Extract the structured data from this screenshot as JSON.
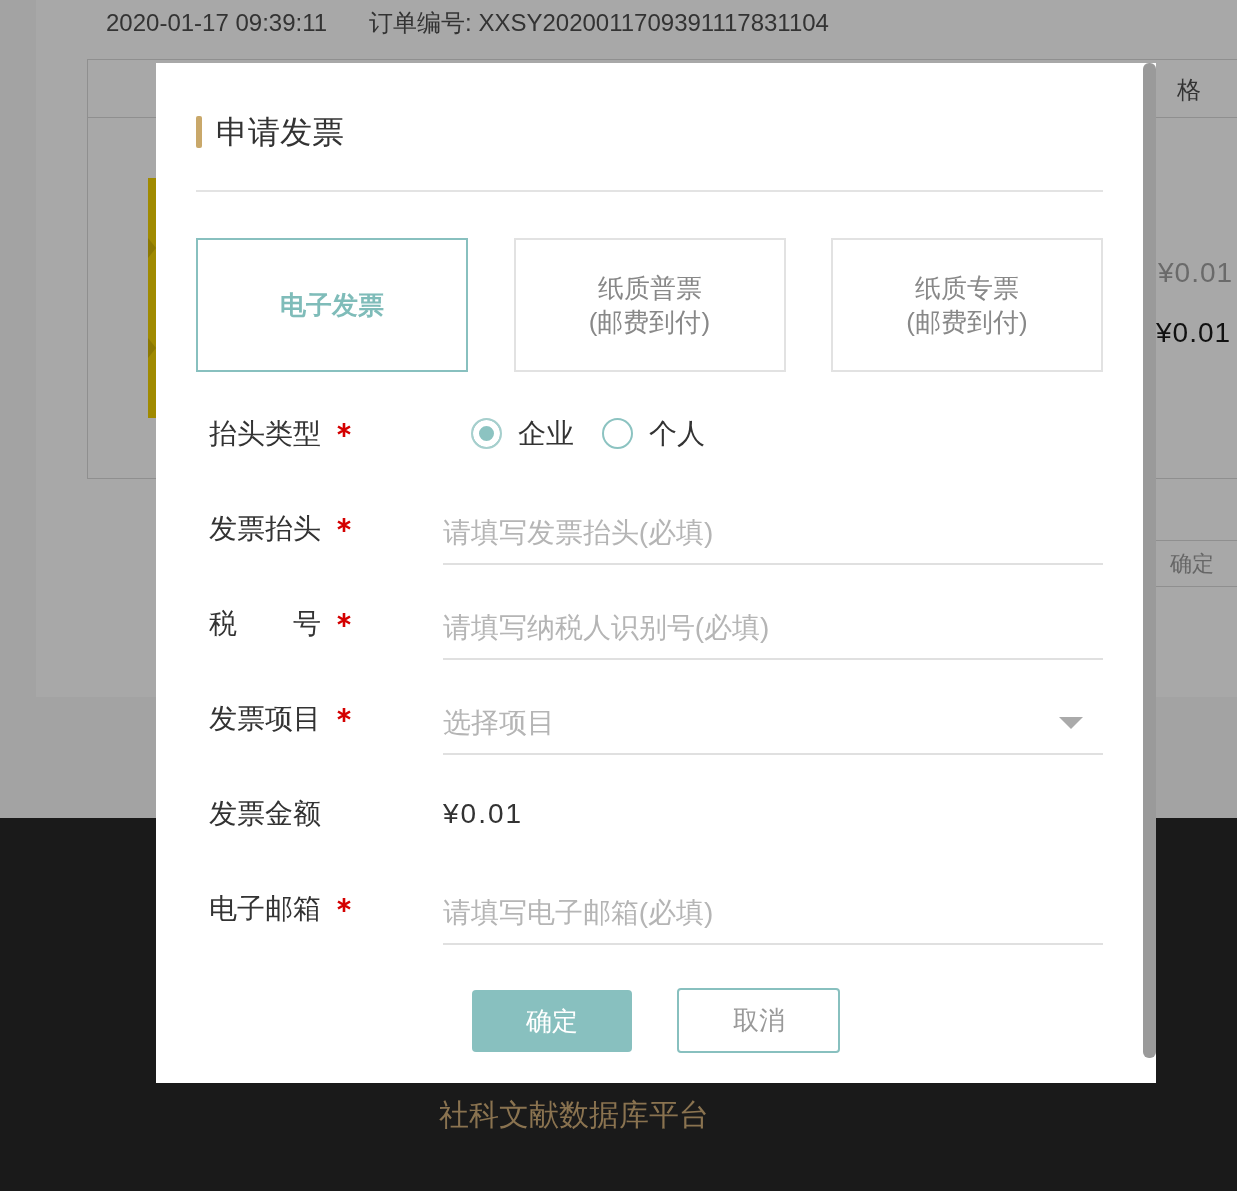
{
  "page": {
    "order_time": "2020-01-17 09:39:11",
    "order_number": "订单编号: XXSY2020011709391117831104",
    "table": {
      "column_header": "格",
      "original_price": "¥0.01",
      "price": "¥0.01",
      "confirm_button": "确定"
    },
    "footer_text": "社科文献数据库平台"
  },
  "dialog": {
    "title": "申请发票",
    "invoice_types": [
      {
        "lines": [
          "电子发票"
        ],
        "selected": true
      },
      {
        "lines": [
          "纸质普票",
          "(邮费到付)"
        ],
        "selected": false
      },
      {
        "lines": [
          "纸质专票",
          "(邮费到付)"
        ],
        "selected": false
      }
    ],
    "fields": [
      {
        "kind": "radio",
        "label": "抬头类型",
        "required": true,
        "options": [
          {
            "label": "企业",
            "selected": true
          },
          {
            "label": "个人",
            "selected": false
          }
        ]
      },
      {
        "kind": "text",
        "label": "发票抬头",
        "required": true,
        "placeholder": "请填写发票抬头(必填)"
      },
      {
        "kind": "text",
        "label": "税　　号",
        "required": true,
        "placeholder": "请填写纳税人识别号(必填)"
      },
      {
        "kind": "select",
        "label": "发票项目",
        "required": true,
        "placeholder": "选择项目"
      },
      {
        "kind": "value",
        "label": "发票金额",
        "required": false,
        "value": "¥0.01"
      },
      {
        "kind": "text",
        "label": "电子邮箱",
        "required": true,
        "placeholder": "请填写电子邮箱(必填)"
      }
    ],
    "buttons": [
      {
        "kind": "primary",
        "label": "确定"
      },
      {
        "kind": "secondary",
        "label": "取消"
      }
    ]
  }
}
